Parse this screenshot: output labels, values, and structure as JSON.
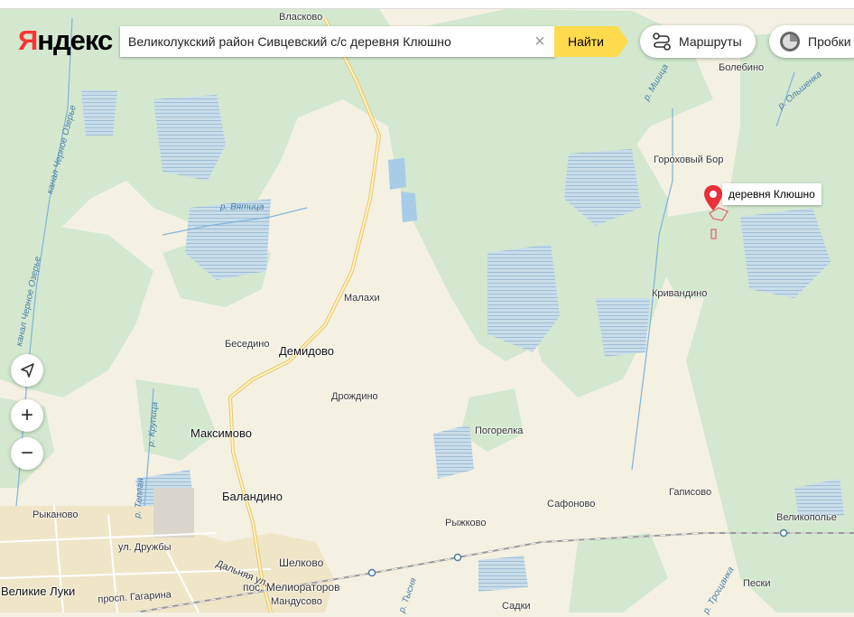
{
  "brand": {
    "logo_first": "Я",
    "logo_rest": "ндекс",
    "accent_color": "#ff3333"
  },
  "search": {
    "value": "Великолукский район Сивцевский с/с деревня Клюшно",
    "button_label": "Найти",
    "clear_icon": "×",
    "button_color": "#ffdb4d"
  },
  "toolbar": {
    "routes_label": "Маршруты",
    "traffic_label": "Пробки"
  },
  "controls": {
    "locate_icon": "navigation-arrow",
    "zoom_in": "+",
    "zoom_out": "−"
  },
  "marker": {
    "label": "деревня Клюшно",
    "color": "#e8313b"
  },
  "places": {
    "vlaskovo": "Власково",
    "bolebino": "Болебино",
    "gorokhovy_bor": "Гороховый Бор",
    "krivandino": "Кривандино",
    "malakhi": "Малахи",
    "besedino": "Беседино",
    "demidovo": "Демидово",
    "drozhdino": "Дрождино",
    "maksimovo": "Максимово",
    "pogorelka": "Погорелка",
    "balandino": "Баландино",
    "gapisovo": "Гаписово",
    "safonovo": "Сафоново",
    "velikopolye": "Великополье",
    "rykanovo": "Рыканово",
    "ryzhkovo": "Рыжково",
    "shelkovo": "Шелково",
    "velikie_luki": "Великие Луки",
    "pos_melioratorov": "пос. Мелиораторов",
    "mandusovo": "Мандусово",
    "sadki": "Садки",
    "peski": "Пески"
  },
  "streets": {
    "ul_druzhby": "ул. Дружбы",
    "dalnyaya": "Дальняя ул.",
    "prosp_gagarina": "просп. Гагарина"
  },
  "water": {
    "kanal_cherny_1": "канал Черное Озерье",
    "kanal_cherny_2": "канал Черное Озерье",
    "r_vyatitsa": "р. Вятица",
    "r_mshitsa": "р. Мшица",
    "r_olshenka": "р. Ольшенка",
    "r_krupitsa": "р. Крупица",
    "r_teplaya": "р. Теплая",
    "r_tysnya": "р. Тысня",
    "r_troshchanka": "р. Трощанка"
  }
}
